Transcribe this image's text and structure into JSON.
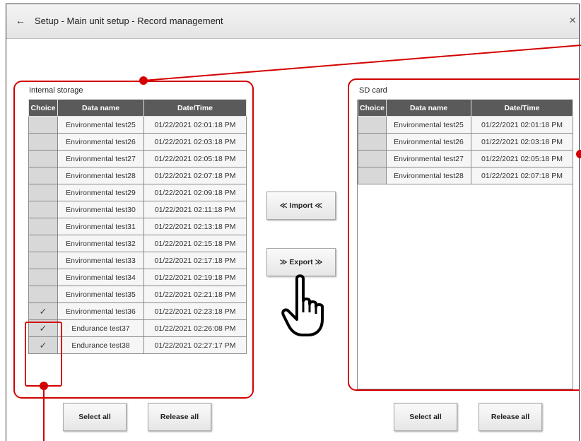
{
  "header": {
    "back_icon": "←",
    "title": "Setup - Main unit setup - Record management",
    "close_icon": "×"
  },
  "internal": {
    "label": "Internal storage",
    "columns": [
      "Choice",
      "Data name",
      "Date/Time"
    ],
    "rows": [
      {
        "choice": "",
        "name": "Environmental test25",
        "time": "01/22/2021 02:01:18 PM"
      },
      {
        "choice": "",
        "name": "Environmental test26",
        "time": "01/22/2021 02:03:18 PM"
      },
      {
        "choice": "",
        "name": "Environmental test27",
        "time": "01/22/2021 02:05:18 PM"
      },
      {
        "choice": "",
        "name": "Environmental test28",
        "time": "01/22/2021 02:07:18 PM"
      },
      {
        "choice": "",
        "name": "Environmental test29",
        "time": "01/22/2021 02:09:18 PM"
      },
      {
        "choice": "",
        "name": "Environmental test30",
        "time": "01/22/2021 02:11:18 PM"
      },
      {
        "choice": "",
        "name": "Environmental test31",
        "time": "01/22/2021 02:13:18 PM"
      },
      {
        "choice": "",
        "name": "Environmental test32",
        "time": "01/22/2021 02:15:18 PM"
      },
      {
        "choice": "",
        "name": "Environmental test33",
        "time": "01/22/2021 02:17:18 PM"
      },
      {
        "choice": "",
        "name": "Environmental test34",
        "time": "01/22/2021 02:19:18 PM"
      },
      {
        "choice": "",
        "name": "Environmental test35",
        "time": "01/22/2021 02:21:18 PM"
      },
      {
        "choice": "✓",
        "name": "Environmental test36",
        "time": "01/22/2021 02:23:18 PM"
      },
      {
        "choice": "✓",
        "name": "Endurance test37",
        "time": "01/22/2021 02:26:08 PM"
      },
      {
        "choice": "✓",
        "name": "Endurance test38",
        "time": "01/22/2021 02:27:17 PM"
      }
    ],
    "select_all": "Select all",
    "release_all": "Release all"
  },
  "sd": {
    "label": "SD card",
    "columns": [
      "Choice",
      "Data name",
      "Date/Time"
    ],
    "rows": [
      {
        "choice": "",
        "name": "Environmental test25",
        "time": "01/22/2021 02:01:18 PM"
      },
      {
        "choice": "",
        "name": "Environmental test26",
        "time": "01/22/2021 02:03:18 PM"
      },
      {
        "choice": "",
        "name": "Environmental test27",
        "time": "01/22/2021 02:05:18 PM"
      },
      {
        "choice": "",
        "name": "Environmental test28",
        "time": "01/22/2021 02:07:18 PM"
      }
    ],
    "select_all": "Select all",
    "release_all": "Release all"
  },
  "transfer": {
    "import_label": "≪ Import ≪",
    "export_label": "≫ Export ≫"
  },
  "annotation_color": "#d40000",
  "pointer_icon": "hand-pointer-icon"
}
